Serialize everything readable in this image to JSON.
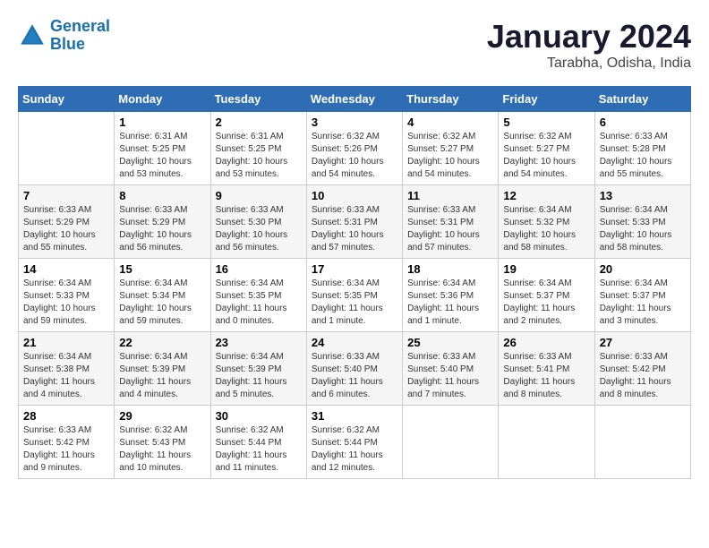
{
  "logo": {
    "line1": "General",
    "line2": "Blue"
  },
  "title": "January 2024",
  "subtitle": "Tarabha, Odisha, India",
  "weekdays": [
    "Sunday",
    "Monday",
    "Tuesday",
    "Wednesday",
    "Thursday",
    "Friday",
    "Saturday"
  ],
  "weeks": [
    [
      {
        "day": "",
        "sunrise": "",
        "sunset": "",
        "daylight": ""
      },
      {
        "day": "1",
        "sunrise": "Sunrise: 6:31 AM",
        "sunset": "Sunset: 5:25 PM",
        "daylight": "Daylight: 10 hours and 53 minutes."
      },
      {
        "day": "2",
        "sunrise": "Sunrise: 6:31 AM",
        "sunset": "Sunset: 5:25 PM",
        "daylight": "Daylight: 10 hours and 53 minutes."
      },
      {
        "day": "3",
        "sunrise": "Sunrise: 6:32 AM",
        "sunset": "Sunset: 5:26 PM",
        "daylight": "Daylight: 10 hours and 54 minutes."
      },
      {
        "day": "4",
        "sunrise": "Sunrise: 6:32 AM",
        "sunset": "Sunset: 5:27 PM",
        "daylight": "Daylight: 10 hours and 54 minutes."
      },
      {
        "day": "5",
        "sunrise": "Sunrise: 6:32 AM",
        "sunset": "Sunset: 5:27 PM",
        "daylight": "Daylight: 10 hours and 54 minutes."
      },
      {
        "day": "6",
        "sunrise": "Sunrise: 6:33 AM",
        "sunset": "Sunset: 5:28 PM",
        "daylight": "Daylight: 10 hours and 55 minutes."
      }
    ],
    [
      {
        "day": "7",
        "sunrise": "Sunrise: 6:33 AM",
        "sunset": "Sunset: 5:29 PM",
        "daylight": "Daylight: 10 hours and 55 minutes."
      },
      {
        "day": "8",
        "sunrise": "Sunrise: 6:33 AM",
        "sunset": "Sunset: 5:29 PM",
        "daylight": "Daylight: 10 hours and 56 minutes."
      },
      {
        "day": "9",
        "sunrise": "Sunrise: 6:33 AM",
        "sunset": "Sunset: 5:30 PM",
        "daylight": "Daylight: 10 hours and 56 minutes."
      },
      {
        "day": "10",
        "sunrise": "Sunrise: 6:33 AM",
        "sunset": "Sunset: 5:31 PM",
        "daylight": "Daylight: 10 hours and 57 minutes."
      },
      {
        "day": "11",
        "sunrise": "Sunrise: 6:33 AM",
        "sunset": "Sunset: 5:31 PM",
        "daylight": "Daylight: 10 hours and 57 minutes."
      },
      {
        "day": "12",
        "sunrise": "Sunrise: 6:34 AM",
        "sunset": "Sunset: 5:32 PM",
        "daylight": "Daylight: 10 hours and 58 minutes."
      },
      {
        "day": "13",
        "sunrise": "Sunrise: 6:34 AM",
        "sunset": "Sunset: 5:33 PM",
        "daylight": "Daylight: 10 hours and 58 minutes."
      }
    ],
    [
      {
        "day": "14",
        "sunrise": "Sunrise: 6:34 AM",
        "sunset": "Sunset: 5:33 PM",
        "daylight": "Daylight: 10 hours and 59 minutes."
      },
      {
        "day": "15",
        "sunrise": "Sunrise: 6:34 AM",
        "sunset": "Sunset: 5:34 PM",
        "daylight": "Daylight: 10 hours and 59 minutes."
      },
      {
        "day": "16",
        "sunrise": "Sunrise: 6:34 AM",
        "sunset": "Sunset: 5:35 PM",
        "daylight": "Daylight: 11 hours and 0 minutes."
      },
      {
        "day": "17",
        "sunrise": "Sunrise: 6:34 AM",
        "sunset": "Sunset: 5:35 PM",
        "daylight": "Daylight: 11 hours and 1 minute."
      },
      {
        "day": "18",
        "sunrise": "Sunrise: 6:34 AM",
        "sunset": "Sunset: 5:36 PM",
        "daylight": "Daylight: 11 hours and 1 minute."
      },
      {
        "day": "19",
        "sunrise": "Sunrise: 6:34 AM",
        "sunset": "Sunset: 5:37 PM",
        "daylight": "Daylight: 11 hours and 2 minutes."
      },
      {
        "day": "20",
        "sunrise": "Sunrise: 6:34 AM",
        "sunset": "Sunset: 5:37 PM",
        "daylight": "Daylight: 11 hours and 3 minutes."
      }
    ],
    [
      {
        "day": "21",
        "sunrise": "Sunrise: 6:34 AM",
        "sunset": "Sunset: 5:38 PM",
        "daylight": "Daylight: 11 hours and 4 minutes."
      },
      {
        "day": "22",
        "sunrise": "Sunrise: 6:34 AM",
        "sunset": "Sunset: 5:39 PM",
        "daylight": "Daylight: 11 hours and 4 minutes."
      },
      {
        "day": "23",
        "sunrise": "Sunrise: 6:34 AM",
        "sunset": "Sunset: 5:39 PM",
        "daylight": "Daylight: 11 hours and 5 minutes."
      },
      {
        "day": "24",
        "sunrise": "Sunrise: 6:33 AM",
        "sunset": "Sunset: 5:40 PM",
        "daylight": "Daylight: 11 hours and 6 minutes."
      },
      {
        "day": "25",
        "sunrise": "Sunrise: 6:33 AM",
        "sunset": "Sunset: 5:40 PM",
        "daylight": "Daylight: 11 hours and 7 minutes."
      },
      {
        "day": "26",
        "sunrise": "Sunrise: 6:33 AM",
        "sunset": "Sunset: 5:41 PM",
        "daylight": "Daylight: 11 hours and 8 minutes."
      },
      {
        "day": "27",
        "sunrise": "Sunrise: 6:33 AM",
        "sunset": "Sunset: 5:42 PM",
        "daylight": "Daylight: 11 hours and 8 minutes."
      }
    ],
    [
      {
        "day": "28",
        "sunrise": "Sunrise: 6:33 AM",
        "sunset": "Sunset: 5:42 PM",
        "daylight": "Daylight: 11 hours and 9 minutes."
      },
      {
        "day": "29",
        "sunrise": "Sunrise: 6:32 AM",
        "sunset": "Sunset: 5:43 PM",
        "daylight": "Daylight: 11 hours and 10 minutes."
      },
      {
        "day": "30",
        "sunrise": "Sunrise: 6:32 AM",
        "sunset": "Sunset: 5:44 PM",
        "daylight": "Daylight: 11 hours and 11 minutes."
      },
      {
        "day": "31",
        "sunrise": "Sunrise: 6:32 AM",
        "sunset": "Sunset: 5:44 PM",
        "daylight": "Daylight: 11 hours and 12 minutes."
      },
      {
        "day": "",
        "sunrise": "",
        "sunset": "",
        "daylight": ""
      },
      {
        "day": "",
        "sunrise": "",
        "sunset": "",
        "daylight": ""
      },
      {
        "day": "",
        "sunrise": "",
        "sunset": "",
        "daylight": ""
      }
    ]
  ]
}
